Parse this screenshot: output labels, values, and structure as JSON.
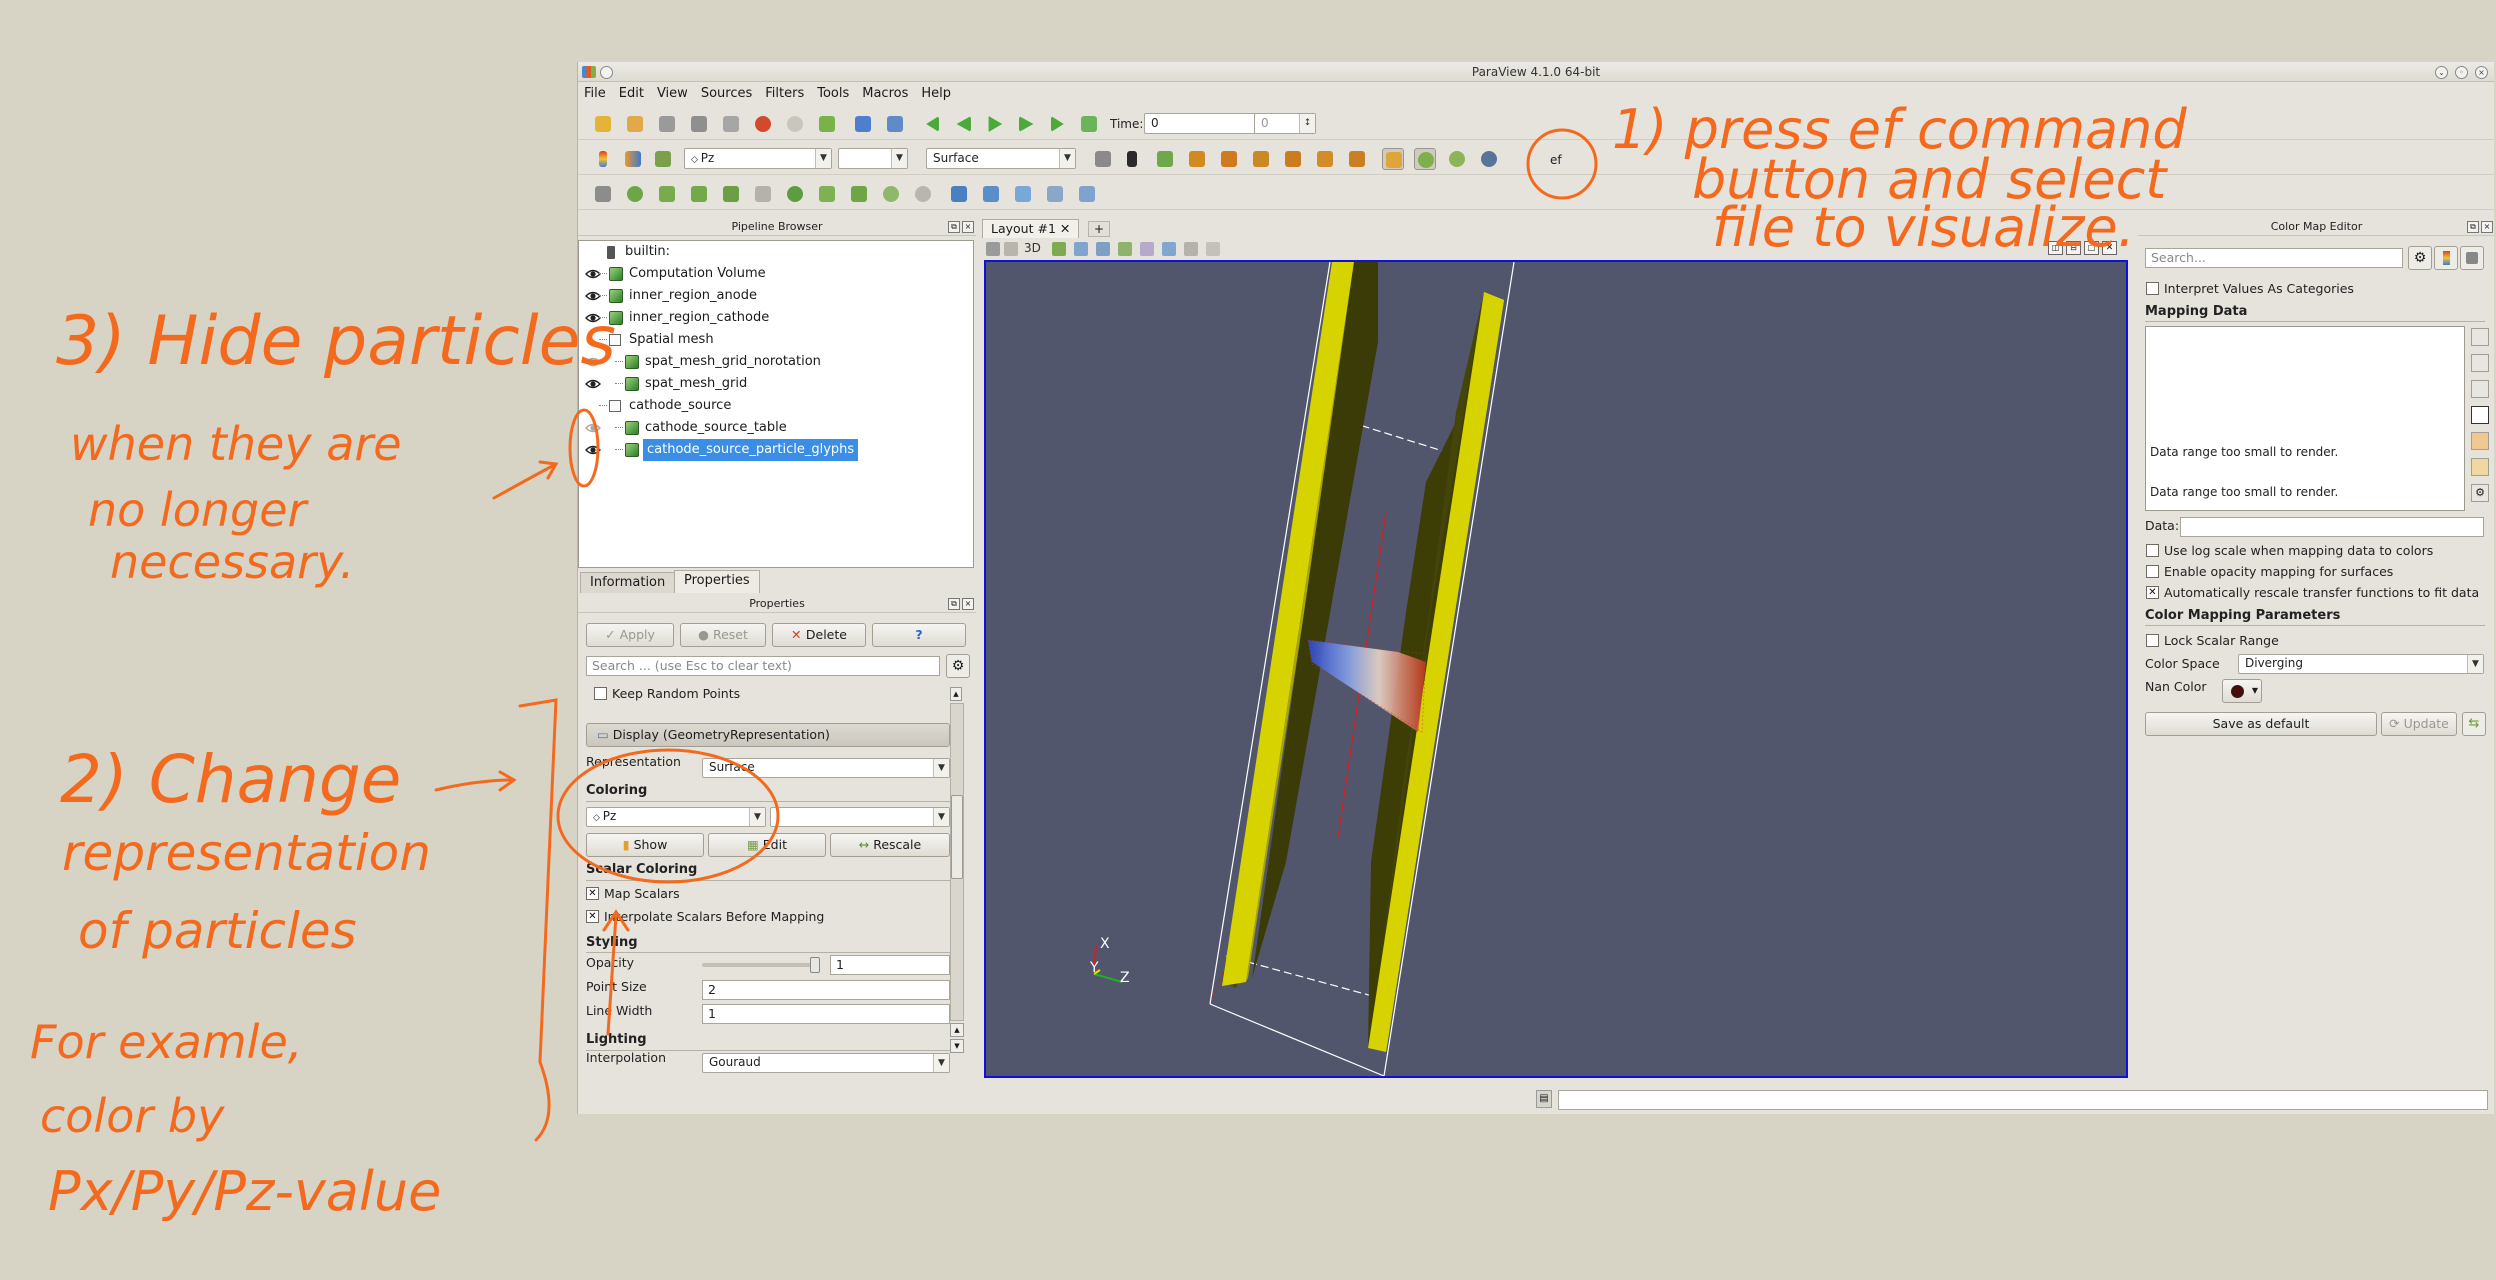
{
  "window": {
    "title": "ParaView 4.1.0 64-bit"
  },
  "menu": [
    "File",
    "Edit",
    "View",
    "Sources",
    "Filters",
    "Tools",
    "Macros",
    "Help"
  ],
  "toolbar": {
    "time_label": "Time:",
    "time_value": "0",
    "time_index": "0",
    "color_by": "Pz",
    "representation": "Surface",
    "ef_label": "ef",
    "view_3d": "3D"
  },
  "pipeline": {
    "header": "Pipeline Browser",
    "root": "builtin:",
    "items": [
      {
        "label": "Computation Volume",
        "visible": true,
        "kind": "cube"
      },
      {
        "label": "inner_region_anode",
        "visible": true,
        "kind": "cube"
      },
      {
        "label": "inner_region_cathode",
        "visible": true,
        "kind": "cube"
      },
      {
        "label": "Spatial mesh",
        "visible": false,
        "kind": "group"
      },
      {
        "label": "spat_mesh_grid_norotation",
        "visible": "dim",
        "kind": "cube"
      },
      {
        "label": "spat_mesh_grid",
        "visible": true,
        "kind": "cube"
      },
      {
        "label": "cathode_source",
        "visible": false,
        "kind": "group"
      },
      {
        "label": "cathode_source_table",
        "visible": "dim",
        "kind": "cube"
      },
      {
        "label": "cathode_source_particle_glyphs",
        "visible": true,
        "kind": "cube",
        "selected": true
      }
    ]
  },
  "tabs": {
    "information": "Information",
    "properties": "Properties"
  },
  "properties": {
    "header": "Properties",
    "apply": "Apply",
    "reset": "Reset",
    "delete": "Delete",
    "help": "?",
    "search_placeholder": "Search ... (use Esc to clear text)",
    "keep_random_points": "Keep Random Points",
    "display_header": "Display (GeometryRepresentation)",
    "representation_label": "Representation",
    "representation_value": "Surface",
    "coloring_title": "Coloring",
    "coloring_value": "Pz",
    "show": "Show",
    "edit": "Edit",
    "rescale": "Rescale",
    "scalar_coloring_title": "Scalar Coloring",
    "map_scalars": "Map Scalars",
    "interpolate_scalars": "Interpolate Scalars Before Mapping",
    "styling_title": "Styling",
    "opacity_label": "Opacity",
    "opacity_value": "1",
    "point_size_label": "Point Size",
    "point_size_value": "2",
    "line_width_label": "Line Width",
    "line_width_value": "1",
    "lighting_title": "Lighting",
    "interpolation_label": "Interpolation",
    "interpolation_value": "Gouraud"
  },
  "layout": {
    "tab_label": "Layout #1",
    "add_tab": "+",
    "view_3d": "3D",
    "axes": {
      "x": "X",
      "y": "Y",
      "z": "Z"
    }
  },
  "color_map": {
    "header": "Color Map Editor",
    "search_placeholder": "Search...",
    "interpret_categories": "Interpret Values As Categories",
    "mapping_data_title": "Mapping Data",
    "range_msg_1": "Data range too small to render.",
    "range_msg_2": "Data range too small to render.",
    "data_label": "Data:",
    "log_scale": "Use log scale when mapping data to colors",
    "opacity_mapping": "Enable opacity mapping for surfaces",
    "auto_rescale": "Automatically rescale transfer functions to fit data",
    "params_title": "Color Mapping Parameters",
    "lock_range": "Lock Scalar Range",
    "color_space_label": "Color Space",
    "color_space_value": "Diverging",
    "nan_color_label": "Nan Color",
    "save_default": "Save as default",
    "update": "Update"
  },
  "annotations": {
    "note1_line1": "1) press ef command",
    "note1_line2": "button and select",
    "note1_line3": "file to visualize.",
    "note2_line1": "2) Change",
    "note2_line2": "representation",
    "note2_line3": "of particles",
    "note3_line1": "3) Hide particles",
    "note3_line2": "when they are",
    "note3_line3": "no longer",
    "note3_line4": "necessary.",
    "note4_line1": "For examle,",
    "note4_line2": "color by",
    "note4_line3": "Px/Py/Pz-value"
  },
  "colors": {
    "accent": "#f36a1e",
    "selection": "#3a8ee6",
    "viewport_bg": "#52566d",
    "viewport_border": "#1010d6",
    "plate": "#d7d300"
  }
}
